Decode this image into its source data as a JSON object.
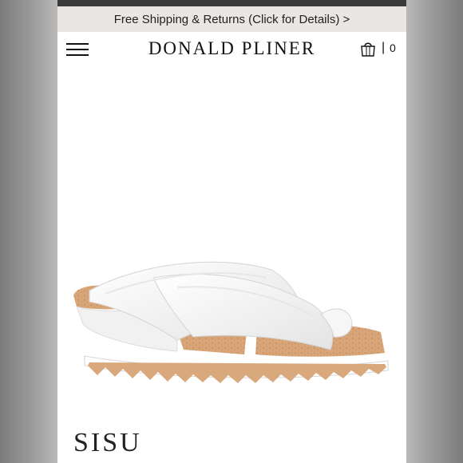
{
  "promo": {
    "text": "Free Shipping & Returns (Click for Details) >"
  },
  "header": {
    "logo": "DONALD PLINER",
    "cart_separator": "|",
    "cart_count": "0",
    "menu_icon": "hamburger-menu-icon",
    "bag_icon": "shopping-bag-icon"
  },
  "product": {
    "name": "SISU",
    "image": "white-wedge-sandal-photo"
  },
  "colors": {
    "promo_bg": "#e9e6e3",
    "page_bg": "#ffffff",
    "text": "#111111"
  }
}
